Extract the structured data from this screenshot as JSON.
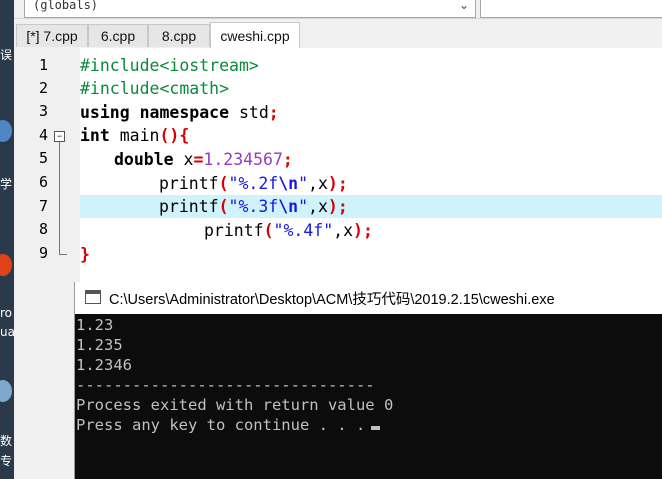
{
  "globals_combo": {
    "value": "(globals)"
  },
  "tabs": [
    {
      "label": "[*] 7.cpp",
      "active": false
    },
    {
      "label": "6.cpp",
      "active": false
    },
    {
      "label": "8.cpp",
      "active": false
    },
    {
      "label": "cweshi.cpp",
      "active": true
    }
  ],
  "editor": {
    "line_numbers": [
      "1",
      "2",
      "3",
      "4",
      "5",
      "6",
      "7",
      "8",
      "9"
    ],
    "highlighted_line": 7,
    "lines": [
      {
        "pre": "#include<iostream>"
      },
      {
        "pre": "#include<cmath>"
      },
      {
        "kw": "using namespace",
        "rest": " std",
        "semi": ";"
      },
      {
        "kw": "int",
        "rest": " main",
        "paren": "(){"
      },
      {
        "kw": "double",
        "rest": " x",
        "op": "=",
        "num": "1.234567",
        "semi": ";"
      },
      {
        "fn": "printf",
        "p1": "(",
        "s1": "\"%.2f",
        "esc": "\\n",
        "s2": "\"",
        "comma": ",x",
        "p2": ");"
      },
      {
        "fn": "printf",
        "p1": "(",
        "s1": "\"%.3f",
        "esc": "\\n",
        "s2": "\"",
        "comma": ",x",
        "p2": ");"
      },
      {
        "fn": "printf",
        "p1": "(",
        "s1": "\"%.4f\"",
        "comma": ",x",
        "p2": ");"
      },
      {
        "brace": "}"
      }
    ]
  },
  "console": {
    "title": "C:\\Users\\Administrator\\Desktop\\ACM\\技巧代码\\2019.2.15\\cweshi.exe",
    "output": [
      "1.23",
      "1.235",
      "1.2346",
      "--------------------------------",
      "Process exited with return value 0",
      "Press any key to continue . . ."
    ]
  },
  "desktop_fragments": [
    "误",
    "学",
    "ro",
    "ua",
    "数",
    "专"
  ]
}
